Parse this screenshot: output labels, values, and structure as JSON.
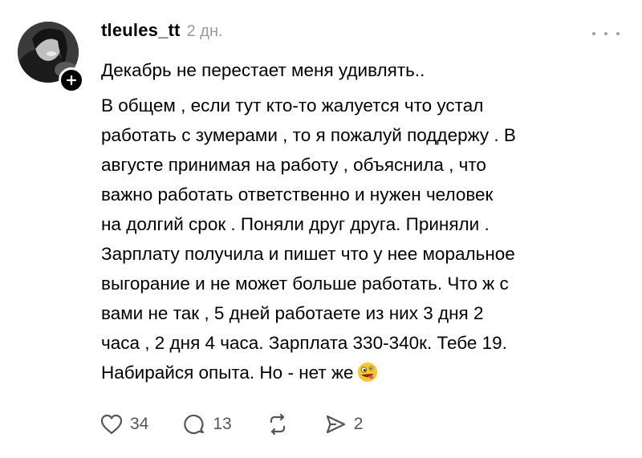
{
  "post": {
    "author": {
      "username": "tleules_tt",
      "avatar_icon": "profile-photo",
      "follow_icon": "plus-icon"
    },
    "timestamp": "2 дн.",
    "more_icon": "more-horizontal-icon",
    "lines": [
      "Декабрь не перестает меня удивлять..",
      "В общем , если тут кто-то жалуется что устал",
      "работать с зумерами , то я пожалуй поддержу . В",
      "августе принимая на работу , объяснила , что",
      "важно работать ответственно и нужен человек",
      "на долгий срок . Поняли друг друга. Приняли .",
      "Зарплату получила и пишет что у нее моральное",
      "выгорание и не может больше работать.  Что ж с",
      "вами не так , 5 дней работаете из них 3 дня 2",
      "часа , 2 дня 4 часа.  Зарплата 330-340к.  Тебе 19.",
      "Набирайся опыта. Но - нет же"
    ],
    "end_emoji": "zany-face-emoji",
    "actions": {
      "like": {
        "icon": "heart-icon",
        "count": "34"
      },
      "reply": {
        "icon": "comment-icon",
        "count": "13"
      },
      "repost": {
        "icon": "repost-icon",
        "count": ""
      },
      "share": {
        "icon": "send-icon",
        "count": "2"
      }
    }
  },
  "colors": {
    "text": "#000000",
    "muted": "#9a9a9a",
    "icon": "#555555",
    "background": "#ffffff",
    "emoji": "#f7c62f"
  }
}
